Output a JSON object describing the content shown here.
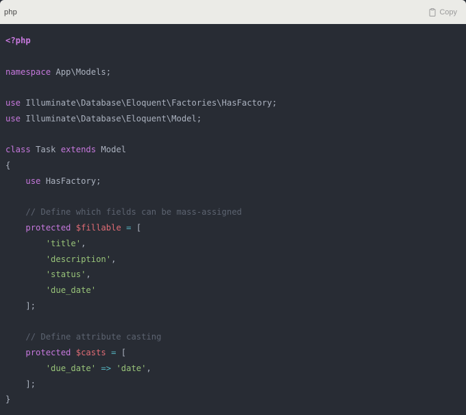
{
  "header": {
    "language": "php",
    "copy_label": "Copy"
  },
  "colors": {
    "background": "#282c34",
    "header_bg": "#ebebe7",
    "keyword": "#c678dd",
    "string": "#98c379",
    "comment": "#5c6370",
    "variable": "#e06c75",
    "plain": "#abb2bf"
  },
  "code": {
    "lines": [
      [
        {
          "t": "tag",
          "v": "<?php"
        }
      ],
      [],
      [
        {
          "t": "kw",
          "v": "namespace"
        },
        {
          "t": "plain",
          "v": " App\\Models;"
        }
      ],
      [],
      [
        {
          "t": "kw",
          "v": "use"
        },
        {
          "t": "plain",
          "v": " Illuminate\\Database\\Eloquent\\Factories\\HasFactory;"
        }
      ],
      [
        {
          "t": "kw",
          "v": "use"
        },
        {
          "t": "plain",
          "v": " Illuminate\\Database\\Eloquent\\Model;"
        }
      ],
      [],
      [
        {
          "t": "kw",
          "v": "class"
        },
        {
          "t": "plain",
          "v": " Task "
        },
        {
          "t": "kw",
          "v": "extends"
        },
        {
          "t": "plain",
          "v": " Model"
        }
      ],
      [
        {
          "t": "plain",
          "v": "{"
        }
      ],
      [
        {
          "t": "plain",
          "v": "    "
        },
        {
          "t": "kw",
          "v": "use"
        },
        {
          "t": "plain",
          "v": " HasFactory;"
        }
      ],
      [],
      [
        {
          "t": "plain",
          "v": "    "
        },
        {
          "t": "cmt",
          "v": "// Define which fields can be mass-assigned"
        }
      ],
      [
        {
          "t": "plain",
          "v": "    "
        },
        {
          "t": "kw",
          "v": "protected"
        },
        {
          "t": "plain",
          "v": " "
        },
        {
          "t": "var",
          "v": "$fillable"
        },
        {
          "t": "plain",
          "v": " "
        },
        {
          "t": "op",
          "v": "="
        },
        {
          "t": "plain",
          "v": " ["
        }
      ],
      [
        {
          "t": "plain",
          "v": "        "
        },
        {
          "t": "str",
          "v": "'title'"
        },
        {
          "t": "plain",
          "v": ","
        }
      ],
      [
        {
          "t": "plain",
          "v": "        "
        },
        {
          "t": "str",
          "v": "'description'"
        },
        {
          "t": "plain",
          "v": ","
        }
      ],
      [
        {
          "t": "plain",
          "v": "        "
        },
        {
          "t": "str",
          "v": "'status'"
        },
        {
          "t": "plain",
          "v": ","
        }
      ],
      [
        {
          "t": "plain",
          "v": "        "
        },
        {
          "t": "str",
          "v": "'due_date'"
        }
      ],
      [
        {
          "t": "plain",
          "v": "    ];"
        }
      ],
      [],
      [
        {
          "t": "plain",
          "v": "    "
        },
        {
          "t": "cmt",
          "v": "// Define attribute casting"
        }
      ],
      [
        {
          "t": "plain",
          "v": "    "
        },
        {
          "t": "kw",
          "v": "protected"
        },
        {
          "t": "plain",
          "v": " "
        },
        {
          "t": "var",
          "v": "$casts"
        },
        {
          "t": "plain",
          "v": " "
        },
        {
          "t": "op",
          "v": "="
        },
        {
          "t": "plain",
          "v": " ["
        }
      ],
      [
        {
          "t": "plain",
          "v": "        "
        },
        {
          "t": "str",
          "v": "'due_date'"
        },
        {
          "t": "plain",
          "v": " "
        },
        {
          "t": "op",
          "v": "=>"
        },
        {
          "t": "plain",
          "v": " "
        },
        {
          "t": "str",
          "v": "'date'"
        },
        {
          "t": "plain",
          "v": ","
        }
      ],
      [
        {
          "t": "plain",
          "v": "    ];"
        }
      ],
      [
        {
          "t": "plain",
          "v": "}"
        }
      ]
    ]
  }
}
